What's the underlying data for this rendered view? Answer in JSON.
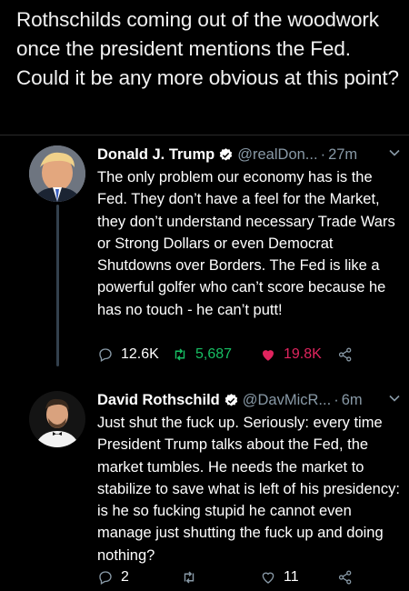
{
  "caption": "Rothschilds coming out of the woodwork once the president mentions the Fed. Could it be any more obvious at this point?",
  "colors": {
    "background": "#000000",
    "secondary_text": "#8899a6",
    "retweet_green": "#17bf63",
    "like_red": "#e0245e",
    "verified_blue": "#1da1f2"
  },
  "tweets": [
    {
      "name": "Donald J. Trump",
      "handle": "@realDon...",
      "separator": "·",
      "time": "27m",
      "text": "The only problem our economy has is the Fed. They don’t have a feel for the Market, they don’t understand necessary Trade Wars or Strong Dollars or even Democrat Shutdowns over Borders. The Fed is like a powerful golfer who can’t score because he has no touch - he can’t putt!",
      "replies": "12.6K",
      "retweets": "5,687",
      "likes": "19.8K",
      "liked": true,
      "retweeted": true,
      "icons": [
        "reply-icon",
        "retweet-icon",
        "heart-icon",
        "share-icon"
      ]
    },
    {
      "name": "David Rothschild",
      "handle": "@DavMicR...",
      "separator": "·",
      "time": "6m",
      "text": "Just shut the fuck up. Seriously: every time President Trump talks about the Fed, the market tumbles. He needs the market to stabilize to save what is left of his presidency: is he so fucking stupid he cannot even manage just shutting the fuck up and doing nothing?",
      "replies": "2",
      "retweets": "",
      "likes": "11",
      "liked": false,
      "retweeted": false,
      "icons": [
        "reply-icon",
        "retweet-icon",
        "heart-icon",
        "share-icon"
      ]
    }
  ]
}
